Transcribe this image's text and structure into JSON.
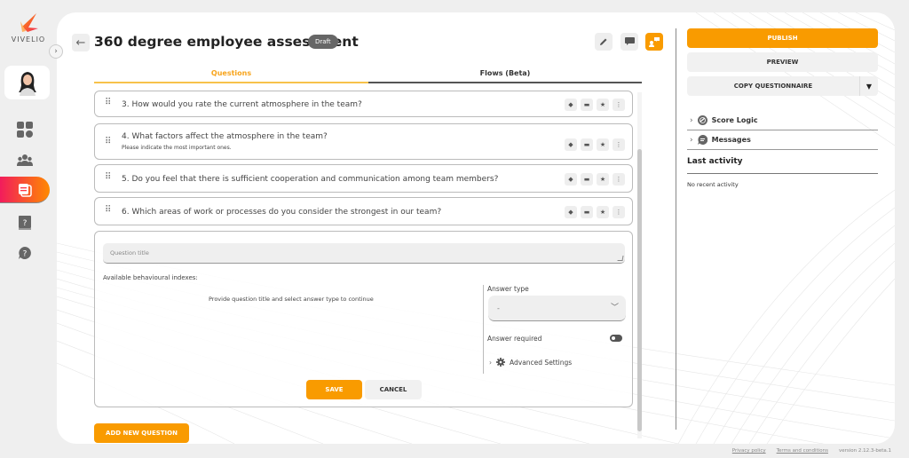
{
  "app": {
    "logo_text": "VIVELIO"
  },
  "sidebar": {
    "collapse_icon": "chevron-right",
    "items": [
      {
        "name": "dashboard",
        "icon": "grid-icon"
      },
      {
        "name": "teams",
        "icon": "users-icon"
      },
      {
        "name": "questionnaires",
        "icon": "documents-icon",
        "active": true
      },
      {
        "name": "knowledge-base",
        "icon": "help-book-icon"
      },
      {
        "name": "support",
        "icon": "help-chat-icon"
      }
    ]
  },
  "header": {
    "title": "360 degree employee assessment",
    "status_badge": "Draft",
    "tools": [
      "edit-icon",
      "comment-icon",
      "collaborate-icon"
    ]
  },
  "tabs": [
    {
      "label": "Questions",
      "active": true
    },
    {
      "label": "Flows (Beta)",
      "active": false
    }
  ],
  "questions": [
    {
      "number": "3.",
      "text": "How would you rate the current atmosphere in the team?",
      "subtitle": ""
    },
    {
      "number": "4.",
      "text": "What factors affect the atmosphere in the team?",
      "subtitle": "Please indicate the most important ones."
    },
    {
      "number": "5.",
      "text": "Do you feel that there is sufficient cooperation and communication among team members?",
      "subtitle": ""
    },
    {
      "number": "6.",
      "text": "Which areas of work or processes do you consider the strongest in our team?",
      "subtitle": ""
    }
  ],
  "editor": {
    "question_title_placeholder": "Question title",
    "question_title_value": "",
    "available_indexes_label": "Available behavioural indexes:",
    "hint": "Provide question title and select answer type to continue",
    "answer_type_label": "Answer type",
    "answer_type_value": "-",
    "answer_required_label": "Answer required",
    "answer_required": false,
    "advanced_settings_label": "Advanced Settings",
    "save_label": "SAVE",
    "cancel_label": "CANCEL"
  },
  "add_question_label": "ADD NEW QUESTION",
  "right_panel": {
    "publish_label": "PUBLISH",
    "preview_label": "PREVIEW",
    "copy_label": "COPY QUESTIONNAIRE",
    "score_logic_label": "Score Logic",
    "messages_label": "Messages",
    "last_activity_label": "Last activity",
    "no_activity_text": "No recent activity"
  },
  "footer": {
    "privacy": "Privacy policy",
    "terms": "Terms and conditions",
    "version": "version 2.12.3-beta.1"
  },
  "colors": {
    "accent": "#f99b00",
    "active_gradient_start": "#f21c5c",
    "active_gradient_end": "#ff8a00"
  }
}
